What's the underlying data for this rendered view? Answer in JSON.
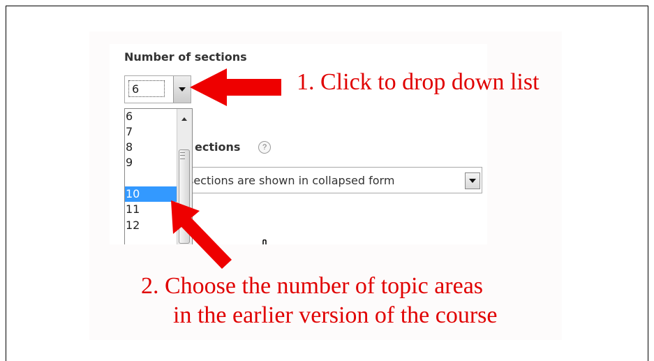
{
  "sections_field": {
    "label": "Number of sections",
    "selected": "6",
    "options": [
      "6",
      "7",
      "8",
      "9",
      "10",
      "11",
      "12"
    ],
    "highlighted": "10"
  },
  "format_field": {
    "label": "ections",
    "help": "?",
    "value": "sections are shown in collapsed form"
  },
  "annotations": {
    "step1": "1. Click to drop down list",
    "step2_line1": "2.  Choose the number of topic areas",
    "step2_line2": "in the earlier version of the course"
  },
  "colors": {
    "annotation": "#e00000",
    "selection": "#3399ff"
  },
  "icons": {
    "help": "help-circle-icon",
    "dropdown": "chevron-down-icon",
    "cursor": "hand-pointer-icon"
  }
}
